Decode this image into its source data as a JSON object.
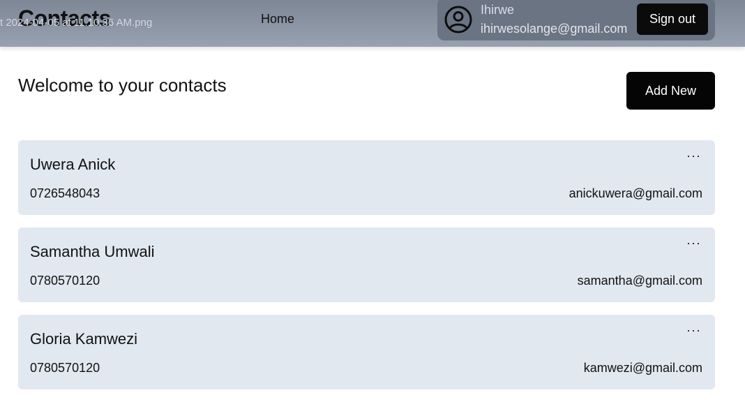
{
  "header": {
    "brand": "Contacts",
    "file_overlay": "t 2024-04-05 at 11.10.36 AM.png",
    "nav_home": "Home",
    "user": {
      "name": "Ihirwe",
      "email": "ihirwesolange@gmail.com",
      "icon": "user-circle-icon"
    },
    "sign_out_label": "Sign out"
  },
  "main": {
    "welcome": "Welcome to your contacts",
    "add_new_label": "Add New",
    "contacts": [
      {
        "name": "Uwera Anick",
        "phone": "0726548043",
        "email": "anickuwera@gmail.com",
        "menu": "···"
      },
      {
        "name": "Samantha Umwali",
        "phone": "0780570120",
        "email": "samantha@gmail.com",
        "menu": "···"
      },
      {
        "name": "Gloria Kamwezi",
        "phone": "0780570120",
        "email": "kamwezi@gmail.com",
        "menu": "···"
      }
    ]
  },
  "colors": {
    "header_bg": "#8b95a4",
    "user_box_bg": "#6a7483",
    "card_bg": "#e2e8f0",
    "button_bg": "#050505"
  }
}
